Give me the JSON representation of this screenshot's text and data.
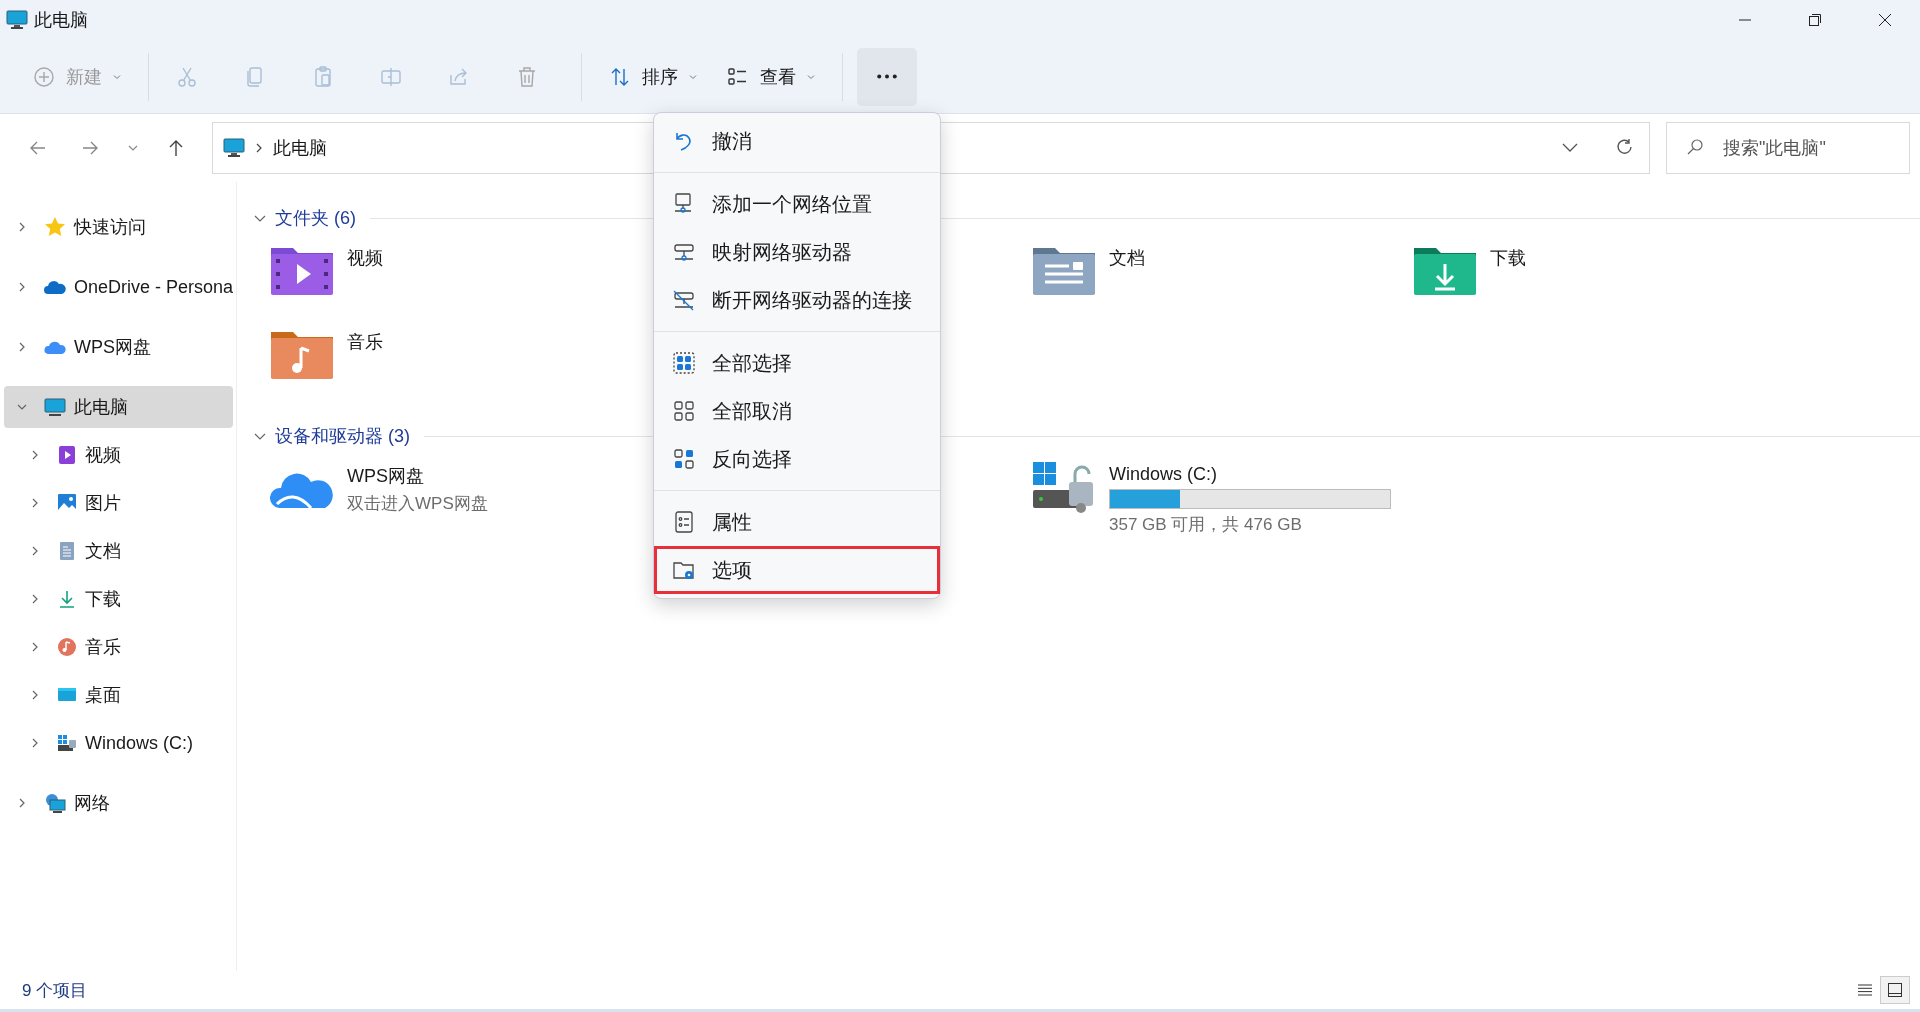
{
  "window": {
    "title": "此电脑"
  },
  "toolbar": [
    {
      "kind": "dropdown",
      "label": "新建",
      "disabled": true,
      "selected": false
    },
    {
      "kind": "icon",
      "disabled": true,
      "selected": false
    },
    {
      "kind": "icon",
      "disabled": true,
      "selected": false
    },
    {
      "kind": "icon",
      "disabled": true,
      "selected": false
    },
    {
      "kind": "icon",
      "disabled": true,
      "selected": false
    },
    {
      "kind": "icon",
      "disabled": true,
      "selected": false
    },
    {
      "kind": "icon",
      "disabled": true,
      "selected": false
    },
    {
      "kind": "dropdown",
      "label": "排序",
      "disabled": false,
      "selected": false
    },
    {
      "kind": "dropdown",
      "label": "查看",
      "disabled": false,
      "selected": false
    },
    {
      "kind": "more",
      "disabled": false,
      "selected": true
    }
  ],
  "address": {
    "path": "此电脑",
    "search_placeholder": "搜索\"此电脑\""
  },
  "sidebar": {
    "items": [
      {
        "label": "快速访问",
        "expanded": false,
        "selected": false
      },
      {
        "label": "OneDrive - Persona",
        "expanded": false,
        "selected": false
      },
      {
        "label": "WPS网盘",
        "expanded": false,
        "selected": false
      },
      {
        "label": "此电脑",
        "expanded": true,
        "selected": true,
        "children": [
          {
            "label": "视频",
            "expanded": false,
            "selected": false
          },
          {
            "label": "图片",
            "expanded": false,
            "selected": false
          },
          {
            "label": "文档",
            "expanded": false,
            "selected": false
          },
          {
            "label": "下载",
            "expanded": false,
            "selected": false
          },
          {
            "label": "音乐",
            "expanded": false,
            "selected": false
          },
          {
            "label": "桌面",
            "expanded": false,
            "selected": false
          },
          {
            "label": "Windows (C:)",
            "expanded": false,
            "selected": false
          }
        ]
      },
      {
        "label": "网络",
        "expanded": false,
        "selected": false
      }
    ]
  },
  "sections": [
    {
      "title": "文件夹 (6)",
      "expanded": true,
      "kind": "folders",
      "items": [
        {
          "name": "视频"
        },
        {
          "name": "文档"
        },
        {
          "name": "下载"
        },
        {
          "name": "音乐"
        }
      ]
    },
    {
      "title": "设备和驱动器 (3)",
      "expanded": true,
      "kind": "drives",
      "items": [
        {
          "name": "WPS网盘",
          "subtitle": "双击进入WPS网盘"
        },
        {
          "name": "Windows (C:)",
          "level": 0.25,
          "subtitle": "357 GB 可用，共 476 GB"
        }
      ]
    }
  ],
  "menu": {
    "groups": [
      [
        {
          "label": "撤消",
          "annotated": false
        }
      ],
      [
        {
          "label": "添加一个网络位置",
          "annotated": false
        },
        {
          "label": "映射网络驱动器",
          "annotated": false
        },
        {
          "label": "断开网络驱动器的连接",
          "annotated": false
        }
      ],
      [
        {
          "label": "全部选择",
          "annotated": false
        },
        {
          "label": "全部取消",
          "annotated": false
        },
        {
          "label": "反向选择",
          "annotated": false
        }
      ],
      [
        {
          "label": "属性",
          "annotated": false
        },
        {
          "label": "选项",
          "annotated": true
        }
      ]
    ]
  },
  "status_bar": {
    "count": "9 个项目",
    "views": [
      {
        "kind": "details",
        "selected": false
      },
      {
        "kind": "tiles",
        "selected": true
      }
    ]
  }
}
